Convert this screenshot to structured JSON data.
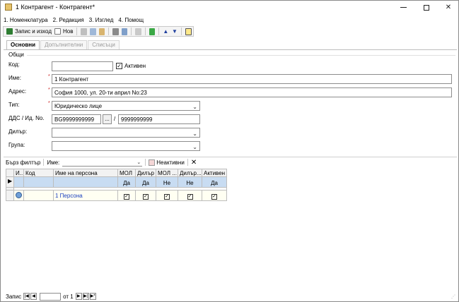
{
  "window": {
    "title": "1 Контрагент - Контрагент*"
  },
  "menu": {
    "items": [
      {
        "label": "1. Номенклатура"
      },
      {
        "label": "2. Редакция"
      },
      {
        "label": "3. Изглед"
      },
      {
        "label": "4. Помощ"
      }
    ]
  },
  "toolbar": {
    "save_close_label": "Запис и изход",
    "new_label": "Нов"
  },
  "tabs": [
    {
      "label": "Основни"
    },
    {
      "label": "Допълнителни"
    },
    {
      "label": "Списъци"
    }
  ],
  "form": {
    "group_label": "Общи",
    "code_label": "Код:",
    "code_value": "",
    "active_label": "Активен",
    "active_checked": "✓",
    "name_label": "Име:",
    "name_value": "1 Контрагент",
    "address_label": "Адрес:",
    "address_value": "София 1000, ул. 20-ти април No:23",
    "type_label": "Тип:",
    "type_value": "Юридическо лице",
    "vat_label": "ДДС / Ид. No.",
    "vat_value": "BG9999999999",
    "vat_button": "...",
    "id_separator": "/",
    "id_value": "9999999999",
    "dealer_label": "Дилър:",
    "dealer_value": "",
    "group_field_label": "Група:",
    "group_value": "",
    "required_mark": "*"
  },
  "filterbar": {
    "quick_filter_label": "Бърз филтър",
    "name_label": "Име:",
    "name_value": "",
    "inactive_label": "Неактивни"
  },
  "grid": {
    "columns": [
      {
        "label": "И..."
      },
      {
        "label": "Код"
      },
      {
        "label": "Име на персона"
      },
      {
        "label": "МОЛ"
      },
      {
        "label": "Дилър"
      },
      {
        "label": "МОЛ ..."
      },
      {
        "label": "Дилър..."
      },
      {
        "label": "Активен"
      }
    ],
    "filter_row": [
      "",
      "",
      "",
      "Да",
      "Да",
      "Не",
      "Не",
      "Да"
    ],
    "rows": [
      {
        "code": "",
        "name": "1 Персона",
        "mol": "✓",
        "dealer": "✓",
        "mol2": "✓",
        "dealer2": "✓",
        "active": "✓"
      }
    ]
  },
  "pager": {
    "label": "Запис",
    "page_value": "",
    "of_label": "от 1"
  },
  "arrows": {
    "prev": "◀",
    "next": "▶",
    "first": "|◀",
    "last": "▶|",
    "new": "▶*",
    "up": "▲",
    "down": "▼",
    "dropdown": "⌄",
    "row_marker": "▶"
  }
}
